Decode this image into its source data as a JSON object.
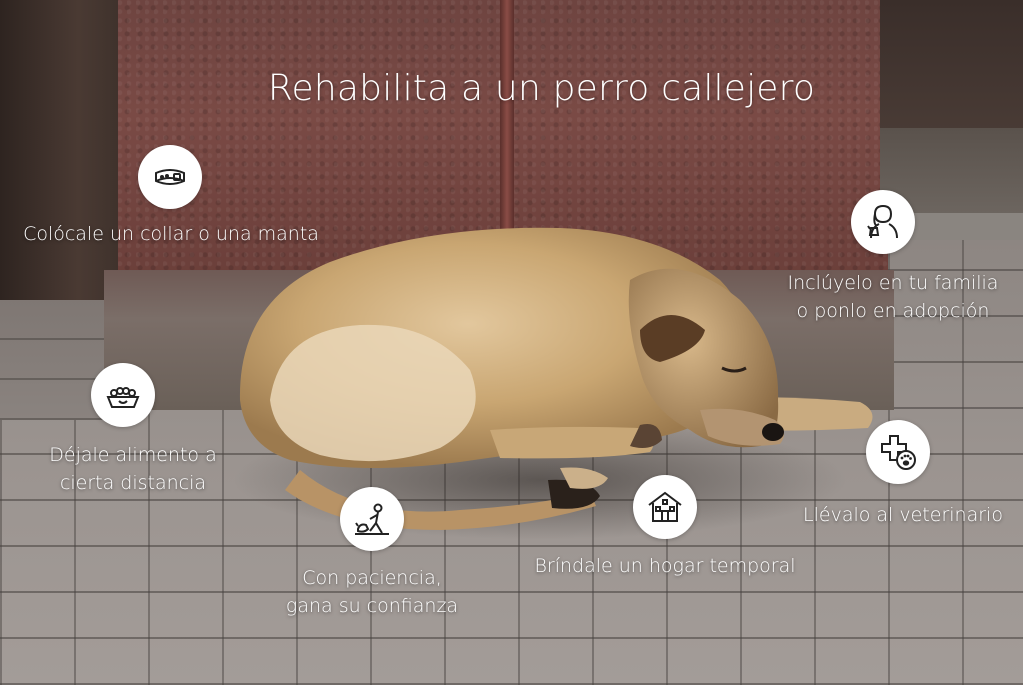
{
  "title": "Rehabilita a un perro callejero",
  "steps": [
    {
      "icon": "collar-icon",
      "label": "Colócale un collar o una manta"
    },
    {
      "icon": "dog-food-bowl-icon",
      "label_line1": "Déjale alimento a",
      "label_line2": "cierta distancia"
    },
    {
      "icon": "person-with-dog-icon",
      "label_line1": "Con paciencia,",
      "label_line2": "gana su confianza"
    },
    {
      "icon": "house-icon",
      "label": "Bríndale un hogar temporal"
    },
    {
      "icon": "veterinary-cross-paw-icon",
      "label": "Llévalo al veterinario"
    },
    {
      "icon": "woman-with-dog-icon",
      "label_line1": "Inclúyelo en tu familia",
      "label_line2": "o ponlo en adopción"
    }
  ],
  "colors": {
    "text": "#ffffff",
    "icon_circle": "#ffffff",
    "icon_stroke": "#222222"
  }
}
